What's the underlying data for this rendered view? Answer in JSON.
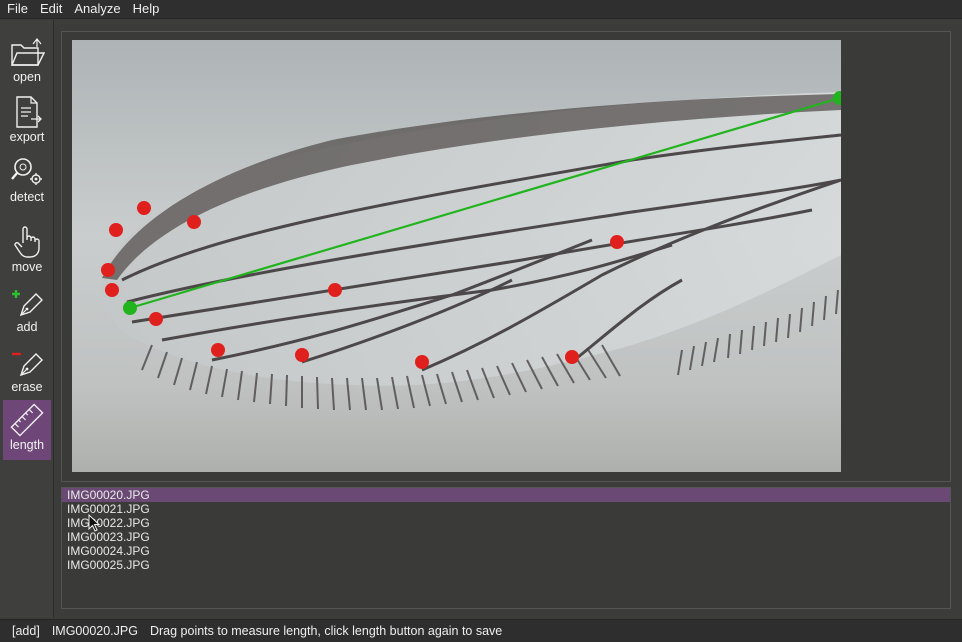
{
  "menu": [
    "File",
    "Edit",
    "Analyze",
    "Help"
  ],
  "tools": [
    {
      "id": "open",
      "label": "open",
      "icon": "folder-open-icon",
      "active": false
    },
    {
      "id": "export",
      "label": "export",
      "icon": "document-export-icon",
      "active": false
    },
    {
      "id": "detect",
      "label": "detect",
      "icon": "magnifier-gear-icon",
      "active": false
    },
    {
      "id": "move",
      "label": "move",
      "icon": "hand-pointer-icon",
      "active": false
    },
    {
      "id": "add",
      "label": "add",
      "icon": "pen-plus-icon",
      "active": false
    },
    {
      "id": "erase",
      "label": "erase",
      "icon": "pen-minus-icon",
      "active": false
    },
    {
      "id": "length",
      "label": "length",
      "icon": "ruler-icon",
      "active": true
    }
  ],
  "files": [
    "IMG00020.JPG",
    "IMG00021.JPG",
    "IMG00022.JPG",
    "IMG00023.JPG",
    "IMG00024.JPG",
    "IMG00025.JPG"
  ],
  "selected_file": "IMG00020.JPG",
  "status": {
    "mode": "[add]",
    "file": "IMG00020.JPG",
    "message": "Drag points to measure length, click length button again to save"
  },
  "colors": {
    "accent": "#6e4778",
    "landmark": "#e0201c",
    "length_line": "#22b41e"
  },
  "image_subject": "mosquito wing micrograph"
}
